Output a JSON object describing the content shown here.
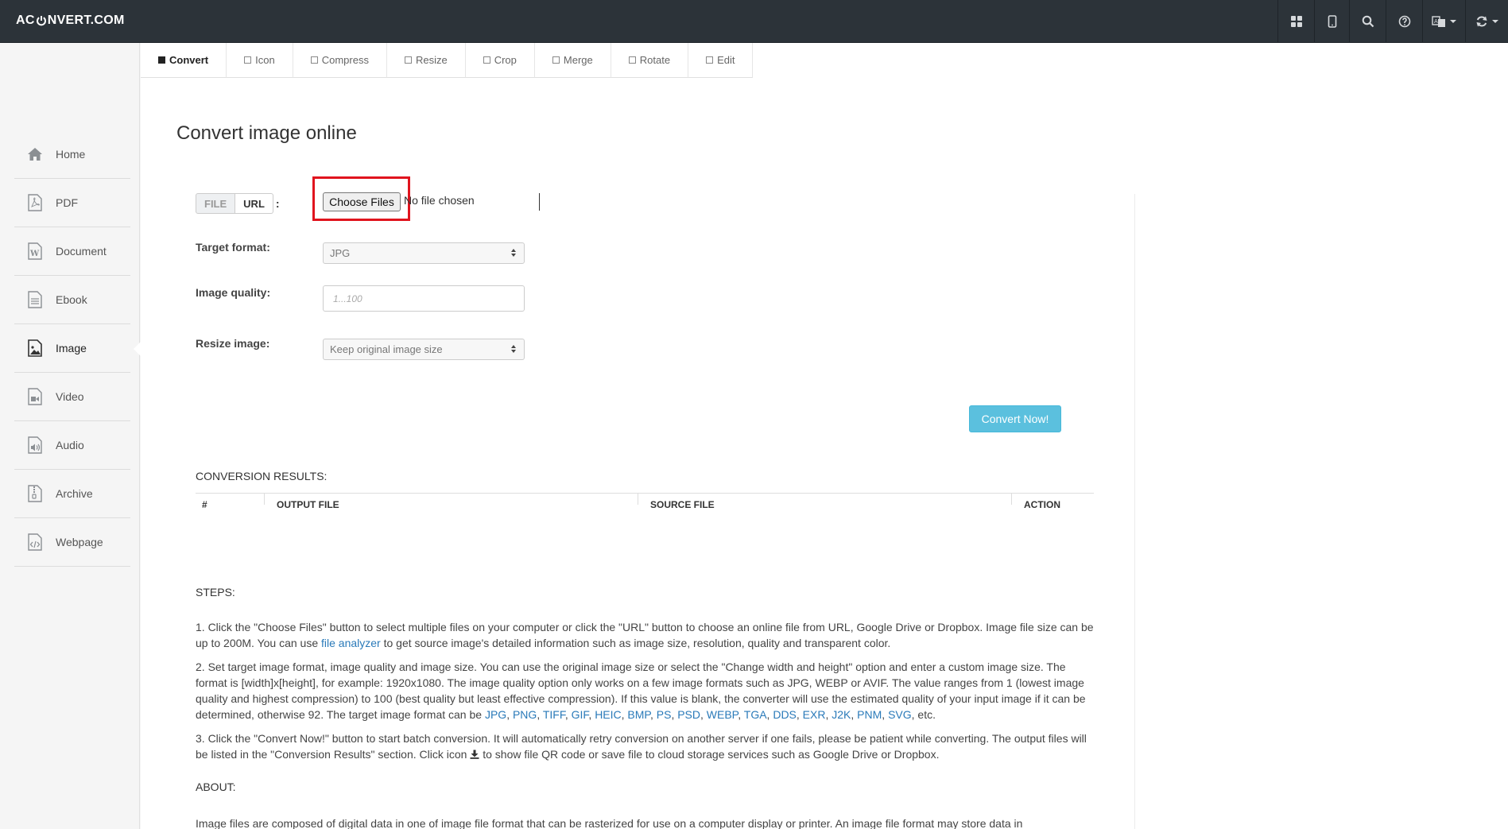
{
  "brand": {
    "left": "AC",
    "right": "NVERT.COM"
  },
  "tabs": [
    {
      "label": "Convert",
      "active": true
    },
    {
      "label": "Icon",
      "active": false
    },
    {
      "label": "Compress",
      "active": false
    },
    {
      "label": "Resize",
      "active": false
    },
    {
      "label": "Crop",
      "active": false
    },
    {
      "label": "Merge",
      "active": false
    },
    {
      "label": "Rotate",
      "active": false
    },
    {
      "label": "Edit",
      "active": false
    }
  ],
  "sidebar": {
    "items": [
      {
        "label": "Home",
        "icon": "home-icon"
      },
      {
        "label": "PDF",
        "icon": "pdf-file-icon"
      },
      {
        "label": "Document",
        "icon": "document-file-icon"
      },
      {
        "label": "Ebook",
        "icon": "ebook-file-icon"
      },
      {
        "label": "Image",
        "icon": "image-file-icon",
        "active": true
      },
      {
        "label": "Video",
        "icon": "video-file-icon"
      },
      {
        "label": "Audio",
        "icon": "audio-file-icon"
      },
      {
        "label": "Archive",
        "icon": "archive-file-icon"
      },
      {
        "label": "Webpage",
        "icon": "webpage-file-icon"
      }
    ]
  },
  "page": {
    "title": "Convert image online"
  },
  "form": {
    "file_label": "FILE",
    "url_label": "URL",
    "colon": ":",
    "choose_files": "Choose Files",
    "no_file": "No file chosen",
    "target_format_label": "Target format:",
    "target_format_value": "JPG",
    "image_quality_label": "Image quality:",
    "image_quality_placeholder": "1...100",
    "resize_label": "Resize image:",
    "resize_value": "Keep original image size",
    "convert_button": "Convert Now!"
  },
  "results": {
    "heading": "CONVERSION RESULTS:",
    "columns": [
      "#",
      "OUTPUT FILE",
      "SOURCE FILE",
      "ACTION"
    ]
  },
  "steps": {
    "heading": "STEPS:",
    "step1_a": "1. Click the \"Choose Files\" button to select multiple files on your computer or click the \"URL\" button to choose an online file from URL, Google Drive or Dropbox. Image file size can be up to 200M. You can use ",
    "step1_link": "file analyzer",
    "step1_b": " to get source image's detailed information such as image size, resolution, quality and transparent color.",
    "step2_a": "2. Set target image format, image quality and image size. You can use the original image size or select the \"Change width and height\" option and enter a custom image size. The format is [width]x[height], for example: 1920x1080. The image quality option only works on a few image formats such as JPG, WEBP or AVIF. The value ranges from 1 (lowest image quality and highest compression) to 100 (best quality but least effective compression). If this value is blank, the converter will use the estimated quality of your input image if it can be determined, otherwise 92. The target image format can be ",
    "step2_formats": [
      "JPG",
      "PNG",
      "TIFF",
      "GIF",
      "HEIC",
      "BMP",
      "PS",
      "PSD",
      "WEBP",
      "TGA",
      "DDS",
      "EXR",
      "J2K",
      "PNM",
      "SVG"
    ],
    "step2_b": ", etc.",
    "step3_a": "3. Click the \"Convert Now!\" button to start batch conversion. It will automatically retry conversion on another server if one fails, please be patient while converting. The output files will be listed in the \"Conversion Results\" section. Click icon ",
    "step3_b": " to show file QR code or save file to cloud storage services such as Google Drive or Dropbox."
  },
  "about": {
    "heading": "ABOUT:",
    "text": "Image files are composed of digital data in one of image file format that can be rasterized for use on a computer display or printer. An image file format may store data in"
  },
  "colors": {
    "navbar": "#2c3339",
    "accent": "#5bc0de",
    "highlight": "#e0141e",
    "link": "#2a7ab9"
  }
}
